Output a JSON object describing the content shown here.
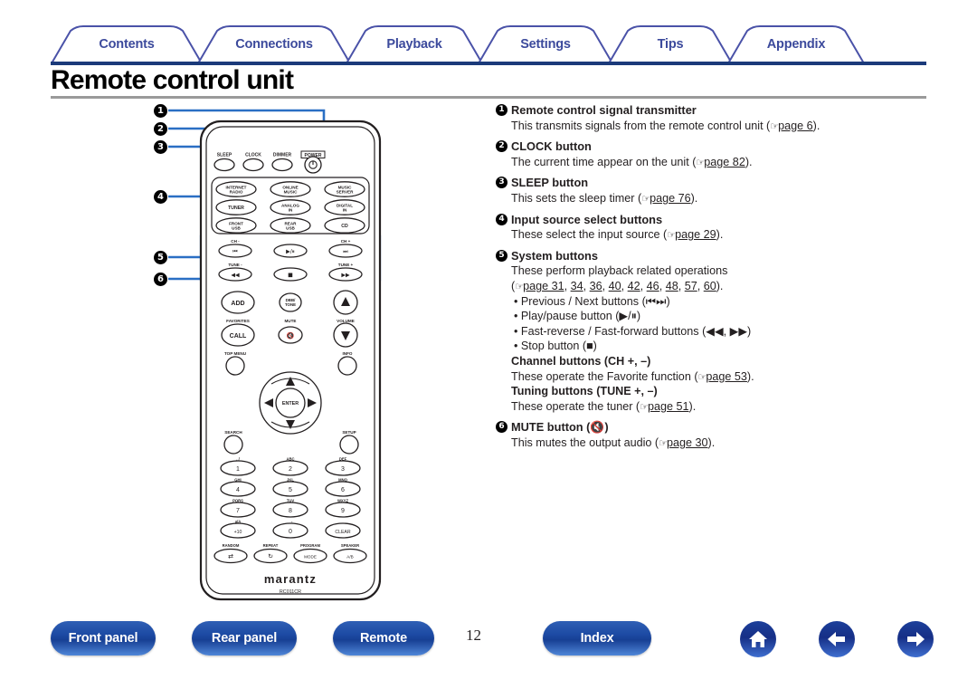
{
  "header": {
    "tabs": [
      {
        "label": "Contents",
        "name": "tab-contents"
      },
      {
        "label": "Connections",
        "name": "tab-connections"
      },
      {
        "label": "Playback",
        "name": "tab-playback"
      },
      {
        "label": "Settings",
        "name": "tab-settings"
      },
      {
        "label": "Tips",
        "name": "tab-tips"
      },
      {
        "label": "Appendix",
        "name": "tab-appendix"
      }
    ],
    "title": "Remote control unit",
    "accent_color": "#3c4a9c",
    "rule_color": "#1b3a7a"
  },
  "descriptions": [
    {
      "num": "1",
      "heading": "Remote control signal transmitter",
      "lines": [
        {
          "pre": "This transmits signals from the remote control unit (",
          "link": "page 6",
          "post": ")."
        }
      ]
    },
    {
      "num": "2",
      "heading": "CLOCK button",
      "lines": [
        {
          "pre": "The current time appear on the unit (",
          "link": "page 82",
          "post": ")."
        }
      ]
    },
    {
      "num": "3",
      "heading": "SLEEP button",
      "lines": [
        {
          "pre": "This sets the sleep timer (",
          "link": "page 76",
          "post": ")."
        }
      ]
    },
    {
      "num": "4",
      "heading": "Input source select buttons",
      "lines": [
        {
          "pre": "These select the input source (",
          "link": "page 29",
          "post": ")."
        }
      ]
    },
    {
      "num": "5",
      "heading": "System buttons",
      "lines": [
        {
          "pre": "These perform playback related operations",
          "link": "",
          "post": ""
        },
        {
          "pre": "(",
          "link": "page 31",
          "post": ", 34, 36, 40, 42, 46, 48, 57, 60)."
        },
        {
          "pre": "• Previous / Next buttons (⏮⏭)",
          "link": "",
          "post": ""
        },
        {
          "pre": "• Play/pause button (▶/⏸)",
          "link": "",
          "post": ""
        },
        {
          "pre": "• Fast-reverse / Fast-forward buttons (◀◀, ▶▶)",
          "link": "",
          "post": ""
        },
        {
          "pre": "• Stop button (■)",
          "link": "",
          "post": ""
        }
      ],
      "subs": [
        {
          "heading": "Channel buttons (CH +, –)",
          "pre": "These operate the Favorite function (",
          "link": "page 53",
          "post": ")."
        },
        {
          "heading": "Tuning buttons (TUNE +, –)",
          "pre": "These operate the tuner (",
          "link": "page 51",
          "post": ")."
        }
      ]
    },
    {
      "num": "6",
      "heading": "MUTE button (🔇)",
      "lines": [
        {
          "pre": "This mutes the output audio (",
          "link": "page 30",
          "post": ")."
        }
      ]
    }
  ],
  "system_page_links": [
    "page 31",
    "34",
    "36",
    "40",
    "42",
    "46",
    "48",
    "57",
    "60"
  ],
  "remote": {
    "brand": "marantz",
    "model": "RC011CR",
    "callouts": [
      "1",
      "2",
      "3",
      "4",
      "5",
      "6"
    ],
    "top_row": [
      {
        "label": "SLEEP",
        "name": "sleep-button"
      },
      {
        "label": "CLOCK",
        "name": "clock-button"
      },
      {
        "label": "DIMMER",
        "name": "dimmer-button"
      },
      {
        "label": "POWER",
        "name": "power-button"
      }
    ],
    "source_buttons": [
      {
        "line1": "INTERNET",
        "line2": "RADIO",
        "name": "internet-radio-button"
      },
      {
        "line1": "ONLINE",
        "line2": "MUSIC",
        "name": "online-music-button"
      },
      {
        "line1": "MUSIC",
        "line2": "SERVER",
        "name": "music-server-button"
      },
      {
        "line1": "TUNER",
        "line2": "",
        "name": "tuner-button"
      },
      {
        "line1": "ANALOG",
        "line2": "IN",
        "name": "analog-in-button"
      },
      {
        "line1": "DIGITAL",
        "line2": "IN",
        "name": "digital-in-button"
      },
      {
        "line1": "FRONT",
        "line2": "USB",
        "name": "front-usb-button"
      },
      {
        "line1": "REAR",
        "line2": "USB",
        "name": "rear-usb-button"
      },
      {
        "line1": "CD",
        "line2": "",
        "name": "cd-button"
      }
    ],
    "system_labels": {
      "ch_minus": "CH -",
      "ch_plus": "CH +",
      "tune_minus": "TUNE -",
      "tune_plus": "TUNE +"
    },
    "system_buttons": [
      {
        "glyph": "⏮",
        "name": "previous-button"
      },
      {
        "glyph": "▶/⏸",
        "name": "play-pause-button"
      },
      {
        "glyph": "⏭",
        "name": "next-button"
      },
      {
        "glyph": "◀◀",
        "name": "fast-reverse-button"
      },
      {
        "glyph": "■",
        "name": "stop-button"
      },
      {
        "glyph": "▶▶",
        "name": "fast-forward-button"
      }
    ],
    "mid_labels": {
      "favorites": "FAVORITES",
      "mute": "MUTE",
      "volume": "VOLUME",
      "add": "ADD",
      "call": "CALL",
      "dbb": "DBB/",
      "tone": "TONE"
    },
    "nav_labels": {
      "top_menu": "TOP MENU",
      "info": "INFO",
      "search": "SEARCH",
      "setup": "SETUP",
      "enter": "ENTER"
    },
    "keypad": [
      {
        "sub": ". /",
        "key": "1"
      },
      {
        "sub": "ABC",
        "key": "2"
      },
      {
        "sub": "DEF",
        "key": "3"
      },
      {
        "sub": "GHI",
        "key": "4"
      },
      {
        "sub": "JKL",
        "key": "5"
      },
      {
        "sub": "MNO",
        "key": "6"
      },
      {
        "sub": "PQRS",
        "key": "7"
      },
      {
        "sub": "TUV",
        "key": "8"
      },
      {
        "sub": "WXYZ",
        "key": "9"
      },
      {
        "sub": "a/A",
        "key": "+10"
      },
      {
        "sub": "_ -",
        "key": "0"
      },
      {
        "sub": "",
        "key": "CLEAR"
      }
    ],
    "bottom_row": [
      {
        "label": "RANDOM",
        "key": "⇄",
        "name": "random-button"
      },
      {
        "label": "REPEAT",
        "key": "↻",
        "name": "repeat-button"
      },
      {
        "label": "PROGRAM",
        "key": "MODE",
        "name": "program-mode-button"
      },
      {
        "label": "SPEAKER",
        "key": "A/B",
        "name": "speaker-ab-button"
      }
    ]
  },
  "footer": {
    "buttons": [
      {
        "label": "Front panel",
        "name": "footer-front-panel-button"
      },
      {
        "label": "Rear panel",
        "name": "footer-rear-panel-button"
      },
      {
        "label": "Remote",
        "name": "footer-remote-button"
      },
      {
        "label": "Index",
        "name": "footer-index-button"
      }
    ],
    "page_number": "12",
    "icons": [
      {
        "name": "home-icon"
      },
      {
        "name": "back-arrow-icon"
      },
      {
        "name": "forward-arrow-icon"
      }
    ]
  }
}
